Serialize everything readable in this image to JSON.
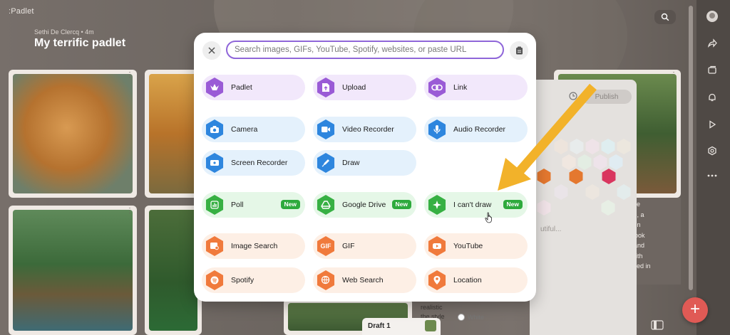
{
  "app": {
    "brand": ":Padlet",
    "author_line": "Sethi De Clercq • 4m",
    "title": "My terrific padlet"
  },
  "background": {
    "publish_label": "Publish",
    "beautiful_text": "utiful...",
    "draft_label": "Draft 1",
    "white_label": "White",
    "story_text": ", in the\ngame, a\ndoor in\nyou look\nront and\nest with\ncovered in",
    "bottom_card_text": "realistic\nthe style"
  },
  "modal": {
    "search_placeholder": "Search images, GIFs, YouTube, Spotify, websites, or paste URL",
    "new_badge": "New",
    "options": [
      {
        "label": "Padlet",
        "icon": "padlet-icon",
        "color": "#9a5bd6"
      },
      {
        "label": "Upload",
        "icon": "upload-icon",
        "color": "#9a5bd6"
      },
      {
        "label": "Link",
        "icon": "link-icon",
        "color": "#9a5bd6"
      },
      {
        "label": "Camera",
        "icon": "camera-icon",
        "color": "#2e86de"
      },
      {
        "label": "Video Recorder",
        "icon": "video-recorder-icon",
        "color": "#2e86de"
      },
      {
        "label": "Audio Recorder",
        "icon": "microphone-icon",
        "color": "#2e86de"
      },
      {
        "label": "Screen Recorder",
        "icon": "screen-recorder-icon",
        "color": "#2e86de"
      },
      {
        "label": "Draw",
        "icon": "draw-icon",
        "color": "#2e86de"
      },
      {
        "label": "Poll",
        "icon": "poll-icon",
        "color": "#37b043"
      },
      {
        "label": "Google Drive",
        "icon": "google-drive-icon",
        "color": "#37b043"
      },
      {
        "label": "I can't draw",
        "icon": "sparkle-icon",
        "color": "#37b043"
      },
      {
        "label": "Image Search",
        "icon": "image-search-icon",
        "color": "#f07a3c"
      },
      {
        "label": "GIF",
        "icon": "gif-icon",
        "color": "#f07a3c"
      },
      {
        "label": "YouTube",
        "icon": "youtube-icon",
        "color": "#f07a3c"
      },
      {
        "label": "Spotify",
        "icon": "spotify-icon",
        "color": "#f07a3c"
      },
      {
        "label": "Web Search",
        "icon": "web-search-icon",
        "color": "#f07a3c"
      },
      {
        "label": "Location",
        "icon": "location-icon",
        "color": "#f07a3c"
      }
    ]
  },
  "colors": {
    "accent_purple": "#8f66d9",
    "new_badge_green": "#2eaa3d",
    "arrow_yellow": "#f2b22a",
    "fab_red": "#e05a55"
  }
}
